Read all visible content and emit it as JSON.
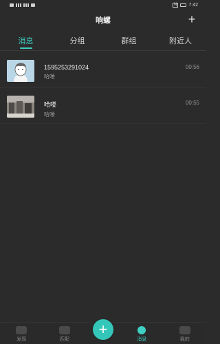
{
  "status": {
    "time": "7:42"
  },
  "header": {
    "title": "响螺",
    "add_icon": "plus-icon"
  },
  "tabs": [
    {
      "label": "消息",
      "active": true
    },
    {
      "label": "分组",
      "active": false
    },
    {
      "label": "群组",
      "active": false
    },
    {
      "label": "附近人",
      "active": false
    }
  ],
  "conversations": [
    {
      "name": "1595253291024",
      "message": "哈喽",
      "time": "00:56"
    },
    {
      "name": "哈喽",
      "message": "哈喽",
      "time": "00:55"
    }
  ],
  "bottom_nav": [
    {
      "label": "发现",
      "icon": "discover-icon",
      "active": false
    },
    {
      "label": "匹配",
      "icon": "match-icon",
      "active": false
    },
    {
      "label": "消息",
      "icon": "message-icon",
      "active": true
    },
    {
      "label": "我的",
      "icon": "profile-icon",
      "active": false
    }
  ],
  "fab": {
    "label": "+"
  },
  "colors": {
    "accent": "#3fd0c4",
    "background": "#2b2b2b"
  }
}
